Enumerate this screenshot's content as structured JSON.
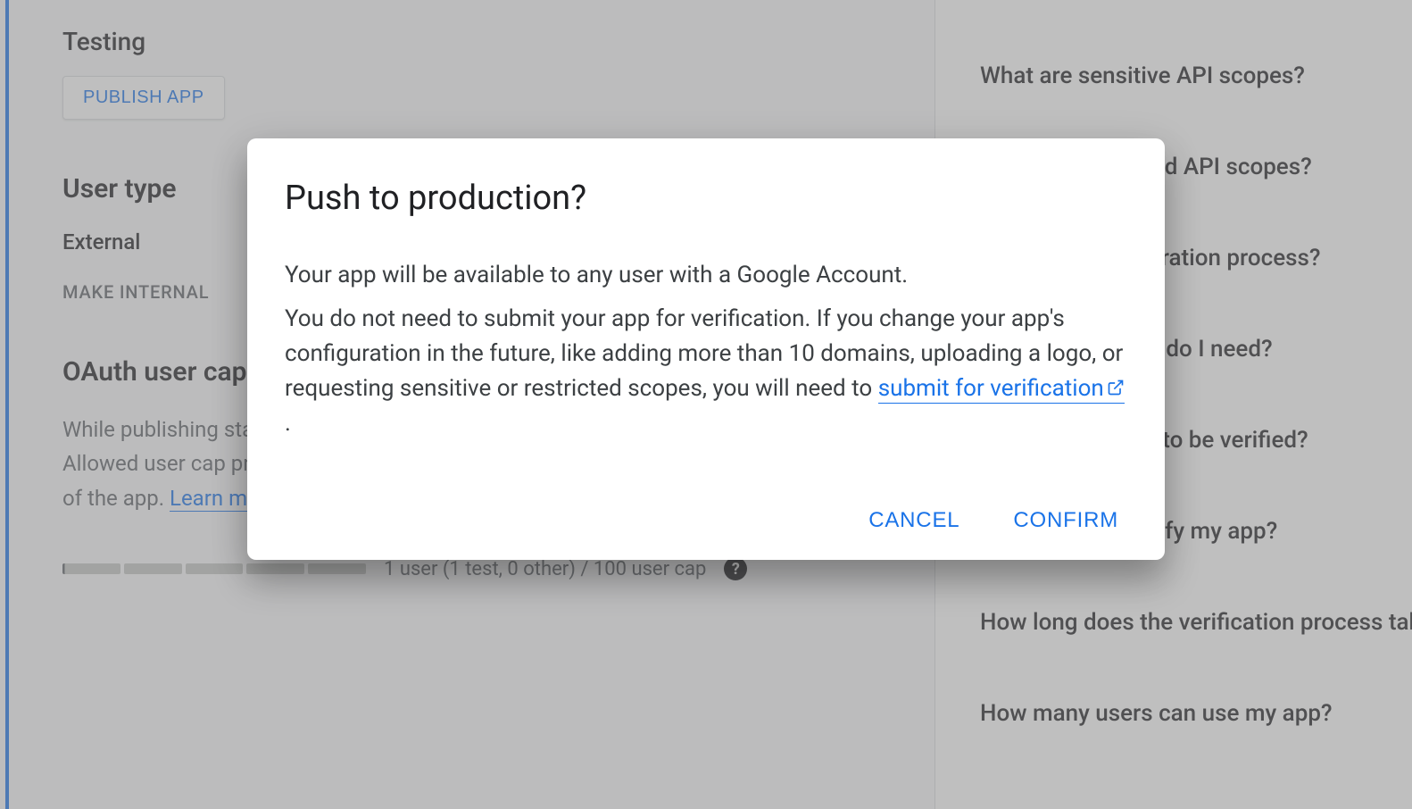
{
  "main": {
    "section1_title": "Testing",
    "publish_button": "PUBLISH APP",
    "section2_title": "User type",
    "user_type_value": "External",
    "make_internal_btn": "MAKE INTERNAL",
    "section3_title": "OAuth user cap",
    "oauth_desc_prefix": "While publishing status is set to \"Testing\", only test users are able to access the app. Allowed user cap prior to app verification is 100, and is counted over the entire lifetime of the app. ",
    "oauth_learn_more": "Learn more",
    "user_cap_text": "1 user (1 test, 0 other) / 100 user cap"
  },
  "faq": {
    "items": [
      "What are sensitive API scopes?",
      "What are restricted API scopes?",
      "What is the registration process?",
      "What information do I need?",
      "Will my app need to be verified?",
      "What if I don't verify my app?",
      "How long does the verification process take?",
      "How many users can use my app?"
    ]
  },
  "dialog": {
    "title": "Push to production?",
    "p1": "Your app will be available to any user with a Google Account.",
    "p2_prefix": "You do not need to submit your app for verification. If you change your app's configuration in the future, like adding more than 10 domains, uploading a logo, or requesting sensitive or restricted scopes, you will need to ",
    "p2_link": "submit for verification",
    "p2_suffix": ".",
    "cancel": "CANCEL",
    "confirm": "CONFIRM"
  }
}
